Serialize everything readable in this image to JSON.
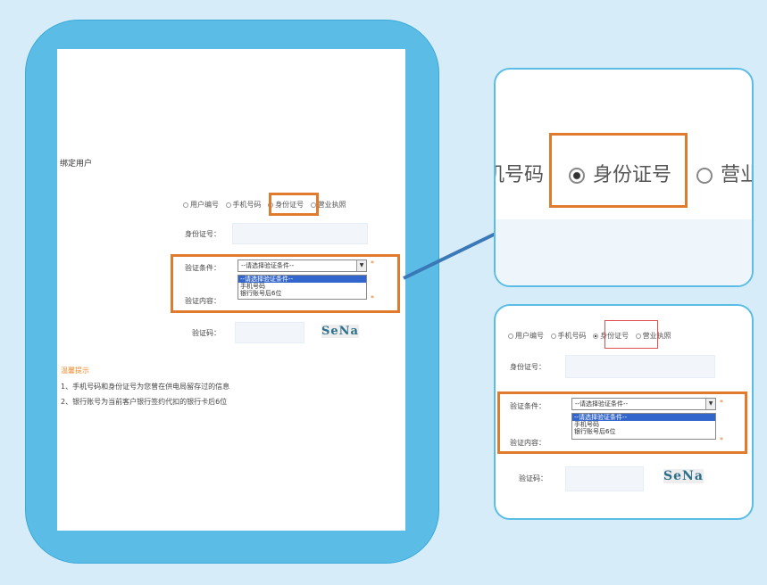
{
  "form": {
    "page_title": "绑定用户",
    "radio_options": [
      "用户编号",
      "手机号码",
      "身份证号",
      "营业执照"
    ],
    "selected_radio": "身份证号",
    "id_label": "身份证号：",
    "condition_label": "验证条件：",
    "condition_selected": "--请选择验证条件--",
    "condition_options": [
      "--请选择验证条件--",
      "手机号码",
      "银行账号后6位"
    ],
    "content_label": "验证内容：",
    "captcha_label": "验证码：",
    "captcha_text": "SeNa",
    "asterisk": "*"
  },
  "tips": {
    "title": "温馨提示",
    "items": [
      "1、手机号码和身份证号为您曾在供电局留存过的信息",
      "2、银行账号为当前客户银行签约代扣的银行卡后6位"
    ]
  },
  "zoom_top": {
    "left_text": "机号码",
    "selected_text": "身份证号",
    "right_text": "营业"
  },
  "colors": {
    "highlight": "#e07a2c",
    "frame": "#5bbde6",
    "background": "#d6ecf8",
    "dropdown_active": "#3366cc",
    "tips_title": "#f08a2c"
  },
  "icons": [
    "radio-icon",
    "dropdown-arrow-icon",
    "captcha-image"
  ]
}
